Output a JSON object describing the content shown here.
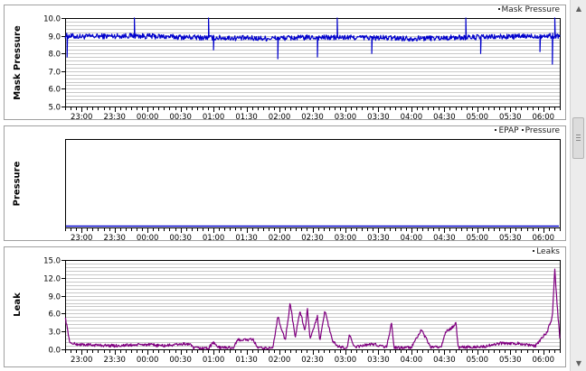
{
  "chart_data": [
    {
      "type": "line",
      "ylabel": "Mask Pressure",
      "ylim": [
        5.0,
        10.0
      ],
      "yticks": [
        "5.0",
        "6.0",
        "7.0",
        "8.0",
        "9.0",
        "10.0"
      ],
      "xticks": [
        "23:00",
        "23:30",
        "00:00",
        "00:30",
        "01:00",
        "01:30",
        "02:00",
        "02:30",
        "03:00",
        "03:30",
        "04:00",
        "04:30",
        "05:00",
        "05:30",
        "06:00"
      ],
      "xlim": [
        "22:45",
        "06:15"
      ],
      "grid": true,
      "legend_position": "top-right",
      "series": [
        {
          "name": "Mask Pressure",
          "color": "#0000cc",
          "profile": [
            [
              0,
              9.0
            ],
            [
              0.03,
              8.95
            ],
            [
              0.13,
              9.0
            ],
            [
              0.27,
              8.9
            ],
            [
              0.4,
              8.85
            ],
            [
              0.5,
              8.9
            ],
            [
              0.6,
              8.9
            ],
            [
              0.7,
              8.85
            ],
            [
              0.8,
              8.9
            ],
            [
              0.9,
              8.95
            ],
            [
              1,
              9.0
            ]
          ],
          "noise": 0.15,
          "spikes": [
            [
              0.004,
              7.8
            ],
            [
              0.14,
              10.0
            ],
            [
              0.29,
              10.0
            ],
            [
              0.3,
              8.2
            ],
            [
              0.43,
              7.7
            ],
            [
              0.51,
              7.8
            ],
            [
              0.55,
              10.0
            ],
            [
              0.62,
              8.0
            ],
            [
              0.81,
              10.0
            ],
            [
              0.84,
              8.0
            ],
            [
              0.96,
              8.1
            ],
            [
              0.985,
              7.4
            ],
            [
              0.99,
              10.0
            ]
          ]
        }
      ]
    },
    {
      "type": "line",
      "ylabel": "Pressure",
      "xticks": [
        "23:00",
        "23:30",
        "00:00",
        "00:30",
        "01:00",
        "01:30",
        "02:00",
        "02:30",
        "03:00",
        "03:30",
        "04:00",
        "04:30",
        "05:00",
        "05:30",
        "06:00"
      ],
      "xlim": [
        "22:45",
        "06:15"
      ],
      "grid": false,
      "legend_position": "top-right",
      "series": [
        {
          "name": "EPAP",
          "color": "#0000cc",
          "flat": 0
        },
        {
          "name": "Pressure",
          "color": "#0000cc",
          "flat": 0
        }
      ]
    },
    {
      "type": "line",
      "ylabel": "Leak",
      "ylim": [
        0.0,
        15.0
      ],
      "yticks": [
        "0.0",
        "3.0",
        "6.0",
        "9.0",
        "12.0",
        "15.0"
      ],
      "xticks": [
        "23:00",
        "23:30",
        "00:00",
        "00:30",
        "01:00",
        "01:30",
        "02:00",
        "02:30",
        "03:00",
        "03:30",
        "04:00",
        "04:30",
        "05:00",
        "05:30",
        "06:00"
      ],
      "xlim": [
        "22:45",
        "06:15"
      ],
      "grid": true,
      "legend_position": "top-right",
      "series": [
        {
          "name": "Leaks",
          "color": "#800080",
          "profile": [
            [
              0,
              5.5
            ],
            [
              0.01,
              1.0
            ],
            [
              0.03,
              0.8
            ],
            [
              0.1,
              0.6
            ],
            [
              0.16,
              0.8
            ],
            [
              0.2,
              0.6
            ],
            [
              0.24,
              0.9
            ],
            [
              0.25,
              0.9
            ],
            [
              0.26,
              0.2
            ],
            [
              0.29,
              0.2
            ],
            [
              0.3,
              1.2
            ],
            [
              0.31,
              0.3
            ],
            [
              0.34,
              0.3
            ],
            [
              0.35,
              1.6
            ],
            [
              0.38,
              1.6
            ],
            [
              0.39,
              0.2
            ],
            [
              0.42,
              0.2
            ],
            [
              0.43,
              5.5
            ],
            [
              0.445,
              1.5
            ],
            [
              0.455,
              7.8
            ],
            [
              0.465,
              2.0
            ],
            [
              0.475,
              6.5
            ],
            [
              0.485,
              3.0
            ],
            [
              0.49,
              7.0
            ],
            [
              0.495,
              1.5
            ],
            [
              0.51,
              5.5
            ],
            [
              0.515,
              1.5
            ],
            [
              0.525,
              6.5
            ],
            [
              0.54,
              1.5
            ],
            [
              0.55,
              0.5
            ],
            [
              0.57,
              0.2
            ],
            [
              0.575,
              2.5
            ],
            [
              0.585,
              0.3
            ],
            [
              0.6,
              0.6
            ],
            [
              0.62,
              0.9
            ],
            [
              0.65,
              0.4
            ],
            [
              0.66,
              4.5
            ],
            [
              0.665,
              0.3
            ],
            [
              0.7,
              0.3
            ],
            [
              0.72,
              3.2
            ],
            [
              0.74,
              0.3
            ],
            [
              0.76,
              0.4
            ],
            [
              0.77,
              3.0
            ],
            [
              0.785,
              3.8
            ],
            [
              0.79,
              4.5
            ],
            [
              0.795,
              0.3
            ],
            [
              0.85,
              0.5
            ],
            [
              0.88,
              1.0
            ],
            [
              0.92,
              1.0
            ],
            [
              0.95,
              0.5
            ],
            [
              0.975,
              3.0
            ],
            [
              0.985,
              5.5
            ],
            [
              0.99,
              13.5
            ],
            [
              0.995,
              7.0
            ],
            [
              1,
              2.0
            ]
          ],
          "noise": 0.25
        }
      ]
    }
  ],
  "colors": {
    "grid": "#c8c8c8",
    "axis": "#000000",
    "panel_border": "#a0a0a0",
    "scrollbar": "#ececec"
  },
  "icons": {
    "scroll_up": "triangle-up-icon",
    "scroll_down": "triangle-down-icon"
  }
}
